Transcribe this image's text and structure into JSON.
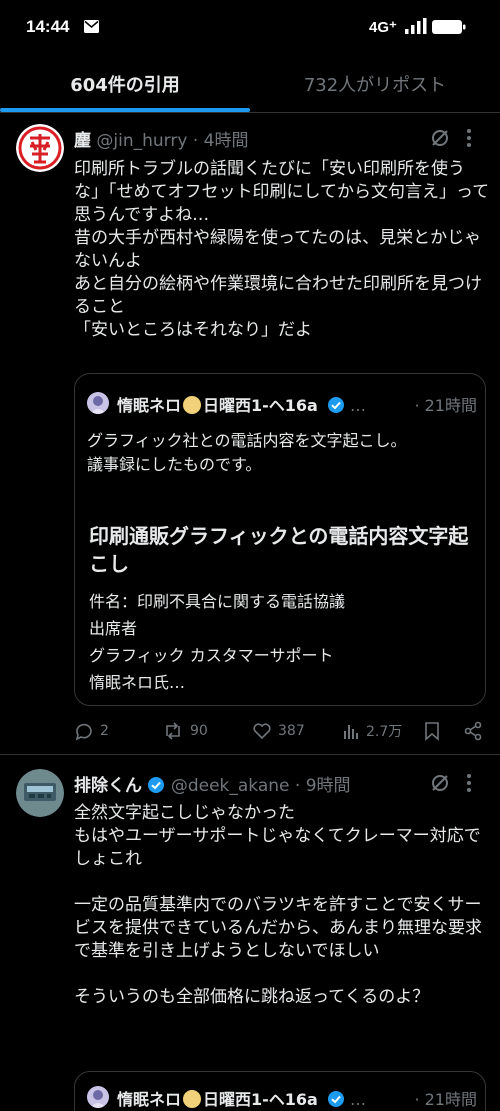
{
  "status_bar": {
    "time": "14:44",
    "network": "4G⁺",
    "icons": [
      "mail-icon",
      "signal-icon",
      "battery-icon"
    ]
  },
  "tabs": [
    {
      "label": "604件の引用",
      "active": true
    },
    {
      "label": "732人がリポスト",
      "active": false
    }
  ],
  "accent_color": "#1d9bf0",
  "posts": [
    {
      "name": "麈",
      "handle": "@jin_hurry",
      "time": "· 4時間",
      "text": "印刷所トラブルの話聞くたびに「安い印刷所を使うな」「せめてオフセット印刷にしてから文句言え」って思うんですよね…\n昔の大手が西村や緑陽を使ってたのは、見栄とかじゃないんよ\nあと自分の絵柄や作業環境に合わせた印刷所を見つけること\n「安いところはそれなり」だよ",
      "quote": {
        "name": "惰眠ネロ",
        "suffix": "日曜西1-ヘ16a",
        "ellipsis": "…",
        "time": "· 21時間",
        "text": "グラフィック社との電話内容を文字起こし。\n議事録にしたものです。",
        "card_title": "印刷通販グラフィックとの電話内容文字起こし",
        "card_text": "件名：印刷不具合に関する電話協議\n出席者\nグラフィック カスタマーサポート\n惰眠ネロ氏…"
      },
      "stats": {
        "replies": "2",
        "reposts": "90",
        "likes": "387",
        "views": "2.7万"
      }
    },
    {
      "name": "排除くん",
      "handle": "@deek_akane",
      "time": "· 9時間",
      "text": "全然文字起こしじゃなかった\nもはやユーザーサポートじゃなくてクレーマー対応でしょこれ\n\n一定の品質基準内でのバラツキを許すことで安くサービスを提供できているんだから、あんまり無理な要求で基準を引き上げようとしないでほしい\n\nそういうのも全部価格に跳ね返ってくるのよ？",
      "quote": {
        "name": "惰眠ネロ",
        "suffix": "日曜西1-ヘ16a",
        "ellipsis": "…",
        "time": "· 21時間"
      }
    }
  ]
}
